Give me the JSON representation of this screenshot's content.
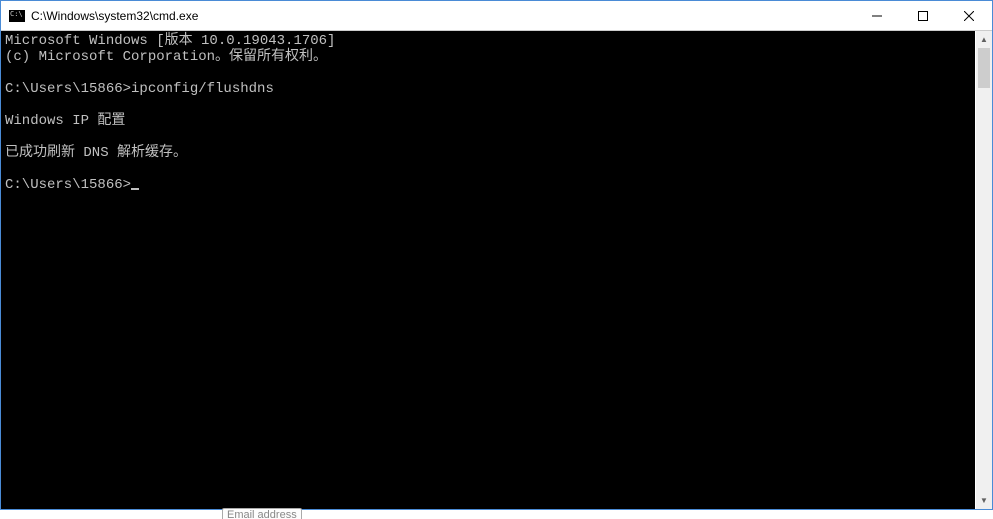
{
  "titlebar": {
    "title": "C:\\Windows\\system32\\cmd.exe"
  },
  "terminal": {
    "lines": [
      "Microsoft Windows [版本 10.0.19043.1706]",
      "(c) Microsoft Corporation。保留所有权利。",
      "",
      "C:\\Users\\15866>ipconfig/flushdns",
      "",
      "Windows IP 配置",
      "",
      "已成功刷新 DNS 解析缓存。",
      "",
      "C:\\Users\\15866>"
    ]
  },
  "below": {
    "fragment": "Email address"
  }
}
